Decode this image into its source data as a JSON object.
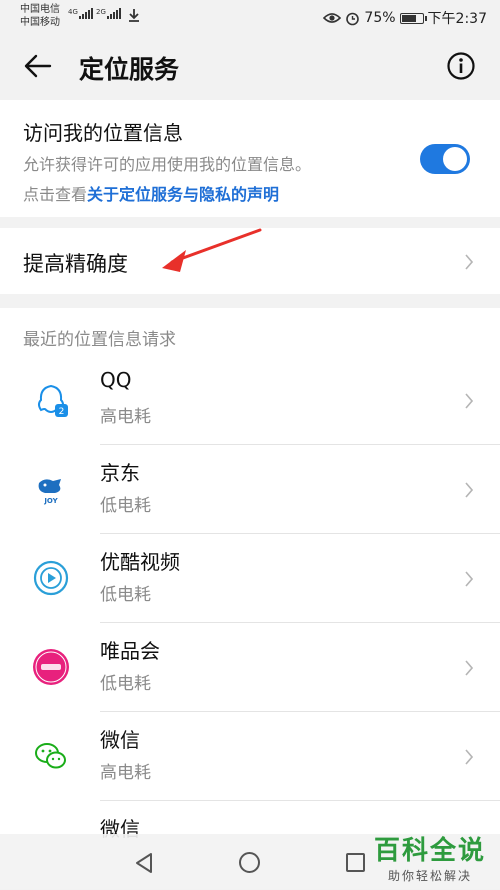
{
  "status": {
    "carrier1": "中国电信",
    "carrier2": "中国移动",
    "net1": "4G",
    "net2": "2G",
    "battery": "75%",
    "battery_level": 0.75,
    "time": "下午2:37"
  },
  "header": {
    "title": "定位服务"
  },
  "access": {
    "title": "访问我的位置信息",
    "description": "允许获得许可的应用使用我的位置信息。",
    "link_prefix": "点击查看",
    "link_text": "关于定位服务与隐私的声明",
    "enabled": true
  },
  "accuracy": {
    "label": "提高精确度"
  },
  "recent": {
    "header": "最近的位置信息请求",
    "apps": [
      {
        "name": "QQ",
        "usage": "高电耗",
        "icon": "qq-icon"
      },
      {
        "name": "京东",
        "usage": "低电耗",
        "icon": "jd-icon"
      },
      {
        "name": "优酷视频",
        "usage": "低电耗",
        "icon": "youku-icon"
      },
      {
        "name": "唯品会",
        "usage": "低电耗",
        "icon": "vip-icon"
      },
      {
        "name": "微信",
        "usage": "高电耗",
        "icon": "wechat-icon"
      },
      {
        "name": "微信",
        "usage": "",
        "icon": "wechat-icon"
      }
    ]
  },
  "watermark": {
    "title": "百科全说",
    "subtitle": "助你轻松解决"
  },
  "colors": {
    "accent": "#1f79e0",
    "link": "#1f6fd6",
    "annotation": "#e8302a",
    "watermark": "#2e9b3e"
  }
}
